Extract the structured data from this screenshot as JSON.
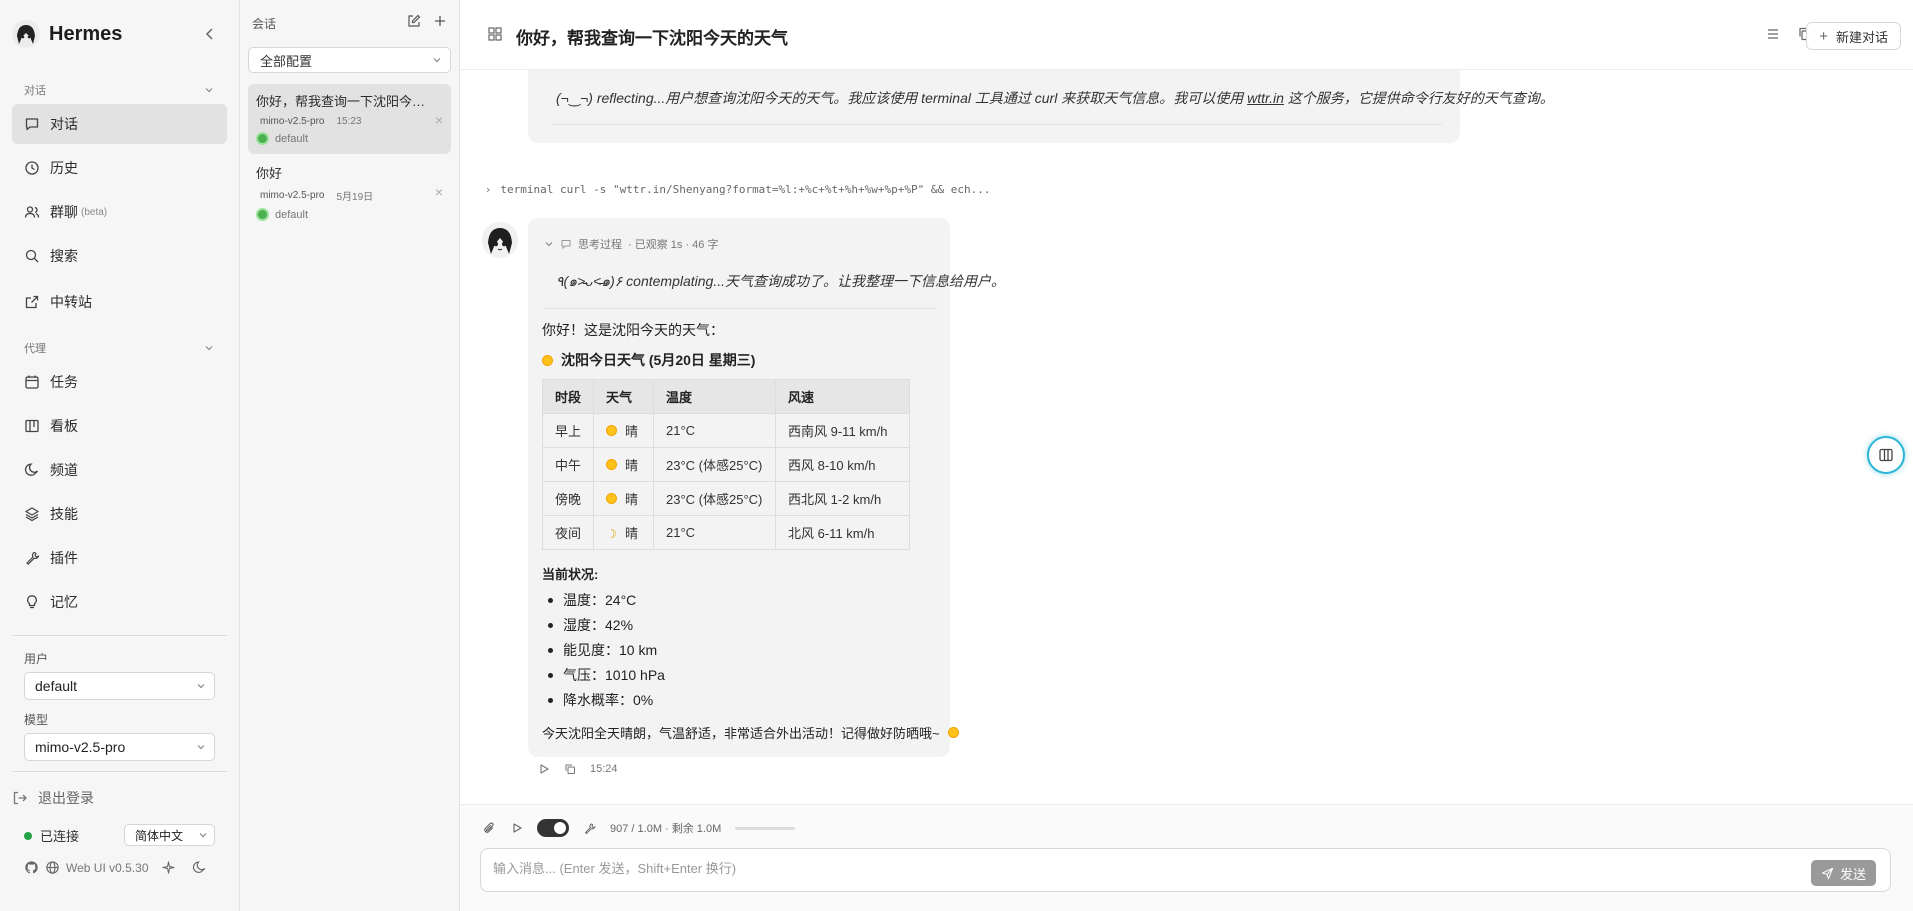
{
  "sidebar": {
    "brand": "Hermes",
    "section_chat": "对话",
    "section_agent": "代理",
    "chat_items": [
      {
        "label": "对话",
        "icon": "chat-icon"
      },
      {
        "label": "历史",
        "icon": "clock-icon"
      },
      {
        "label": "群聊",
        "badge": "(beta)",
        "icon": "users-icon"
      },
      {
        "label": "搜索",
        "icon": "search-icon"
      },
      {
        "label": "中转站",
        "icon": "external-link-icon"
      }
    ],
    "agent_items": [
      {
        "label": "任务",
        "icon": "calendar-icon"
      },
      {
        "label": "看板",
        "icon": "board-icon"
      },
      {
        "label": "频道",
        "icon": "moon-icon"
      },
      {
        "label": "技能",
        "icon": "layers-icon"
      },
      {
        "label": "插件",
        "icon": "wrench-icon"
      },
      {
        "label": "记忆",
        "icon": "lightbulb-icon"
      }
    ],
    "user_label": "用户",
    "user_value": "default",
    "model_label": "模型",
    "model_value": "mimo-v2.5-pro",
    "logout": "退出登录",
    "connection": "已连接",
    "language": "简体中文",
    "version": "Web UI v0.5.30"
  },
  "conversations": {
    "header": "会话",
    "filter": "全部配置",
    "items": [
      {
        "title": "你好，帮我查询一下沈阳今天的天气",
        "model": "mimo-v2.5-pro",
        "time": "15:23",
        "profile": "default",
        "active": true
      },
      {
        "title": "你好",
        "model": "mimo-v2.5-pro",
        "time": "5月19日",
        "profile": "default",
        "active": false
      }
    ]
  },
  "main": {
    "title": "你好，帮我查询一下沈阳今天的天气",
    "new_chat": "新建对话",
    "prev_thinking_prefix": "(¬‿¬) reflecting...用户想查询沈阳今天的天气。我应该使用 terminal 工具通过 curl 来获取天气信息。我可以使用 ",
    "prev_thinking_link": "wttr.in",
    "prev_thinking_suffix": " 这个服务，它提供命令行友好的天气查询。",
    "tool_call": "terminal  curl -s \"wttr.in/Shenyang?format=%l:+%c+%t+%h+%w+%p+%P\" && ech...",
    "message": {
      "thinking_label": "思考过程",
      "thinking_meta": "· 已观察 1s · 46 字",
      "thinking_text": "٩(๑˃̵ᴗ˂̵๑)۶ contemplating...天气查询成功了。让我整理一下信息给用户。",
      "greeting": "你好！这是沈阳今天的天气：",
      "weather_title": "沈阳今日天气 (5月20日 星期三)",
      "table": {
        "headers": [
          "时段",
          "天气",
          "温度",
          "风速"
        ],
        "rows": [
          {
            "period": "早上",
            "icon": "sun-icon",
            "weather": "晴",
            "temp": "21°C",
            "wind": "西南风 9-11 km/h"
          },
          {
            "period": "中午",
            "icon": "sun-icon",
            "weather": "晴",
            "temp": "23°C (体感25°C)",
            "wind": "西风 8-10 km/h"
          },
          {
            "period": "傍晚",
            "icon": "sun-icon",
            "weather": "晴",
            "temp": "23°C (体感25°C)",
            "wind": "西北风 1-2 km/h"
          },
          {
            "period": "夜间",
            "icon": "moon-icon",
            "weather": "晴",
            "temp": "21°C",
            "wind": "北风 6-11 km/h"
          }
        ]
      },
      "status_title": "当前状况:",
      "status_items": [
        "温度：24°C",
        "湿度：42%",
        "能见度：10 km",
        "气压：1010 hPa",
        "降水概率：0%"
      ],
      "closing": "今天沈阳全天晴朗，气温舒适，非常适合外出活动！记得做好防晒哦~",
      "time": "15:24"
    },
    "composer": {
      "usage": "907 / 1.0M · 剩余 1.0M",
      "placeholder": "输入消息... (Enter 发送，Shift+Enter 换行)",
      "send": "发送"
    }
  }
}
